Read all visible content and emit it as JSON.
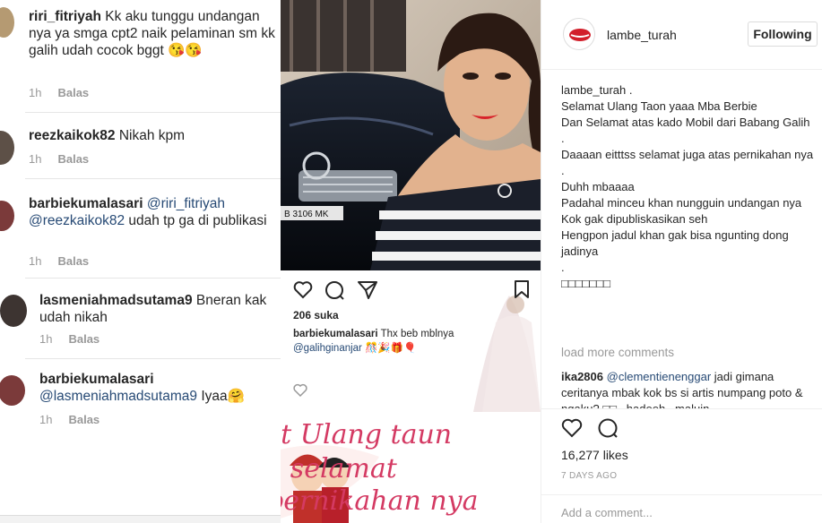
{
  "left_comments": [
    {
      "username": "riri_fitriyah",
      "text": "Kk aku tunggu undangan nya ya smga cpt2 naik pelaminan sm kk galih udah cocok bggt 😘😘",
      "time": "1h",
      "reply": "Balas"
    },
    {
      "username": "reezkaikok82",
      "text": "Nikah kpm",
      "time": "1h",
      "reply": "Balas"
    },
    {
      "username": "barbiekumalasari",
      "mention": "@riri_fitriyah @reezkaikok82",
      "text": "udah tp ga di publikasi",
      "time": "1h",
      "reply": "Balas"
    },
    {
      "username": "lasmeniahmadsutama9",
      "text": "Bneran kak udah nikah",
      "time": "1h",
      "reply": "Balas"
    },
    {
      "username": "barbiekumalasari",
      "mention": "@lasmeniahmadsutama9",
      "text": "Iyaa🤗",
      "time": "1h",
      "reply": "Balas"
    }
  ],
  "middle_post": {
    "likes": "206 suka",
    "caption_user": "barbiekumalasari",
    "caption_text": "Thx beb mblnya",
    "caption_mention": "@galihginanjar",
    "caption_emoji": "🎊🎉🎁🎈",
    "plate": "B 3106 MK",
    "greeting_lines": [
      "Selamat Ulang taun",
      "Dan selamat",
      "Atas pernikahan nya"
    ]
  },
  "right_post": {
    "username": "lambe_turah",
    "follow_label": "Following",
    "caption": "lambe_turah .\nSelamat Ulang Taon yaaa Mba Berbie\nDan Selamat atas kado Mobil dari Babang Galih\n.\nDaaaan eitttss selamat juga atas pernikahan nya\n.\nDuhh mbaaaa\nPadahal minceu khan nungguin undangan nya\nKok gak dipubliskasikan seh\nHengpon jadul khan gak bisa ngunting dong jadinya\n.\n□□□□□□□",
    "load_more": "load more comments",
    "comment_user": "ika2806",
    "comment_mention": "@clementienenggar",
    "comment_text": "jadi gimana ceritanya mbak kok bs si artis numpang poto & ngaku? □□ . hadeeh . maluin",
    "likes": "16,277 likes",
    "time": "7 DAYS AGO",
    "add_comment": "Add a comment..."
  },
  "icons": [
    "heart-icon",
    "comment-icon",
    "share-icon",
    "bookmark-icon"
  ],
  "colors": {
    "mention": "#274a75",
    "greeting": "#d43a63",
    "meta": "#999999"
  }
}
